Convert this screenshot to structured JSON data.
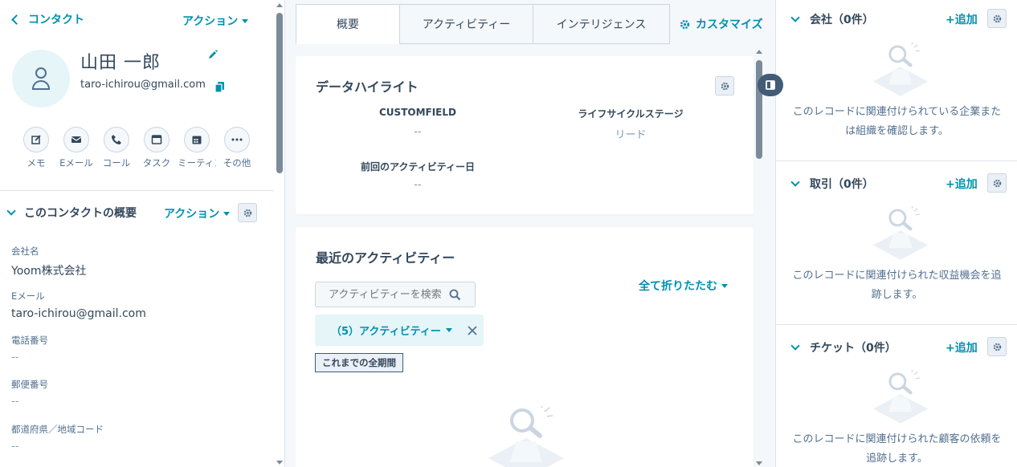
{
  "left": {
    "back_label": "コンタクト",
    "actions_label": "アクション",
    "contact": {
      "name": "山田 一郎",
      "email": "taro-ichirou@gmail.com"
    },
    "quick_actions": [
      {
        "label": "メモ",
        "icon": "note-icon"
      },
      {
        "label": "Eメール",
        "icon": "email-icon"
      },
      {
        "label": "コール",
        "icon": "call-icon"
      },
      {
        "label": "タスク",
        "icon": "task-icon"
      },
      {
        "label": "ミーティング",
        "icon": "meeting-icon"
      },
      {
        "label": "その他",
        "icon": "more-icon"
      }
    ],
    "summary": {
      "title": "このコンタクトの概要",
      "actions_label": "アクション",
      "properties": [
        {
          "label": "会社名",
          "value": "Yoom株式会社"
        },
        {
          "label": "Eメール",
          "value": "taro-ichirou@gmail.com"
        },
        {
          "label": "電話番号",
          "value": "--"
        },
        {
          "label": "郵便番号",
          "value": "--"
        },
        {
          "label": "都道府県／地域コード",
          "value": "--"
        }
      ]
    }
  },
  "middle": {
    "tabs": [
      {
        "label": "概要"
      },
      {
        "label": "アクティビティー"
      },
      {
        "label": "インテリジェンス"
      }
    ],
    "customize_label": "カスタマイズ",
    "highlights": {
      "title": "データハイライト",
      "items": [
        {
          "label": "CUSTOMFIELD",
          "value": "--"
        },
        {
          "label": "ライフサイクルステージ",
          "value": "リード"
        },
        {
          "label": "前回のアクティビティー日",
          "value": "--"
        }
      ]
    },
    "activity": {
      "title": "最近のアクティビティー",
      "collapse_all": "全て折りたたむ",
      "search_placeholder": "アクティビティーを検索",
      "filter_label": "（5）アクティビティー",
      "period_label": "これまでの全期間"
    }
  },
  "right": {
    "add_label": "+追加",
    "sections": [
      {
        "title": "会社（0件）",
        "text": "このレコードに関連付けられている企業または組織を確認します。"
      },
      {
        "title": "取引（0件）",
        "text": "このレコードに関連付けられた収益機会を追跡します。"
      },
      {
        "title": "チケット（0件）",
        "text": "このレコードに関連付けられた顧客の依頼を追跡します。"
      }
    ]
  },
  "colors": {
    "accent": "#0091ae",
    "text": "#33475b",
    "muted": "#516f90",
    "border": "#cbd6e2"
  }
}
